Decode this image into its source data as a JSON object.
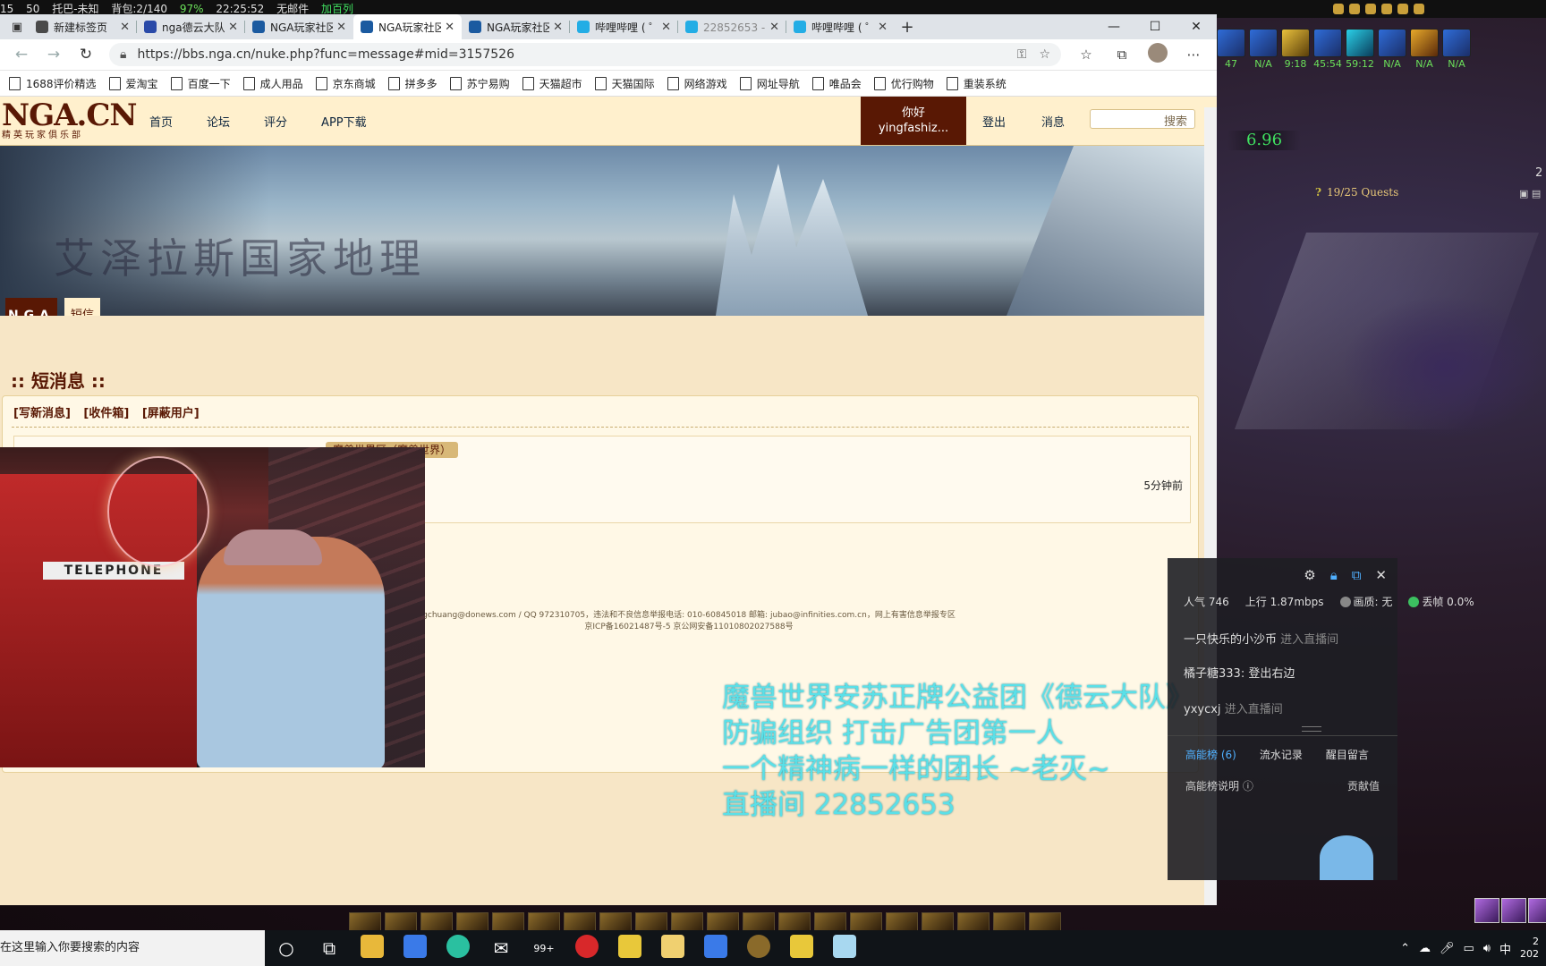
{
  "game": {
    "topbar": [
      "15",
      "50",
      "托巴-未知",
      "背包:2/140",
      "97%",
      "22:25:52",
      "无邮件",
      "加百列"
    ],
    "buffs": [
      "47",
      "N/A",
      "9:18",
      "45:54",
      "59:12",
      "N/A",
      "N/A",
      "N/A"
    ],
    "speed": "6.96",
    "quests": "19/25 Quests",
    "side_number": "2"
  },
  "browser": {
    "tabs": [
      {
        "title": "新建标签页",
        "color": "#4a4a4a"
      },
      {
        "title": "nga德云大队",
        "color": "#2a4aa8"
      },
      {
        "title": "NGA玩家社区",
        "color": "#1b5aa0"
      },
      {
        "title": "NGA玩家社区",
        "color": "#1b5aa0"
      },
      {
        "title": "NGA玩家社区",
        "color": "#1b5aa0"
      },
      {
        "title": "哔哩哔哩 ( ゜-",
        "color": "#23ade5"
      },
      {
        "title": "22852653 - 哔",
        "color": "#23ade5"
      },
      {
        "title": "哔哩哔哩 ( ゜-",
        "color": "#23ade5"
      }
    ],
    "url": "https://bbs.nga.cn/nuke.php?func=message#mid=3157526",
    "bookmarks": [
      "1688评价精选",
      "爱淘宝",
      "百度一下",
      "成人用品",
      "京东商城",
      "拼多多",
      "苏宁易购",
      "天猫超市",
      "天猫国际",
      "网络游戏",
      "网址导航",
      "唯品会",
      "优行购物",
      "重装系统"
    ]
  },
  "nga": {
    "logo": "NGA.CN",
    "logo_sub": "精英玩家俱乐部",
    "nav": [
      "首页",
      "论坛",
      "评分",
      "APP下载"
    ],
    "hello": "你好",
    "username": "yingfashiz...",
    "logout": "登出",
    "messages": "消息",
    "search_placeholder": "搜索",
    "banner_title": "艾泽拉斯国家地理",
    "tab_nga": "NGA",
    "tab_sms": "短信",
    "page_title": ":: 短消息 ::",
    "actions": [
      "[写新消息]",
      "[收件箱]",
      "[屏蔽用户]"
    ],
    "msg_tag": "魔兽世界区（魔兽世界）",
    "msg_time": "5分钟前",
    "footer_line1": "gchuang@donews.com / QQ 972310705，违法和不良信息举报电话: 010-60845018 邮箱: jubao@infinities.com.cn，网上有害信息举报专区",
    "footer_line2": "京ICP备16021487号-5 京公网安备11010802027588号"
  },
  "overlay": {
    "booth_sign": "TELEPHONE",
    "lines": [
      "魔兽世界安苏正牌公益团《德云大队》",
      "防骗组织  打击广告团第一人",
      "一个精神病一样的团长  ~老灭~",
      "直播间 22852653"
    ]
  },
  "stream_panel": {
    "popularity_label": "人气",
    "popularity": "746",
    "upload_label": "上行",
    "upload": "1.87mbps",
    "quality_label": "画质: 无",
    "drop_label": "丢帧 0.0%",
    "chat": [
      {
        "user": "一只快乐的小沙币",
        "text": "进入直播间",
        "sys": true
      },
      {
        "user": "橘子糖333:",
        "text": "登出右边",
        "sys": false
      },
      {
        "user": "yxycxj",
        "text": "进入直播间",
        "sys": true
      }
    ],
    "tabs": [
      "高能榜 (6)",
      "流水记录",
      "醒目留言"
    ],
    "explain": "高能榜说明",
    "contrib": "贡献值"
  },
  "taskbar": {
    "search_placeholder": "在这里输入你要搜索的内容",
    "badge": "99+",
    "ime": "中",
    "clock_top": "2",
    "clock_bottom": "202"
  }
}
